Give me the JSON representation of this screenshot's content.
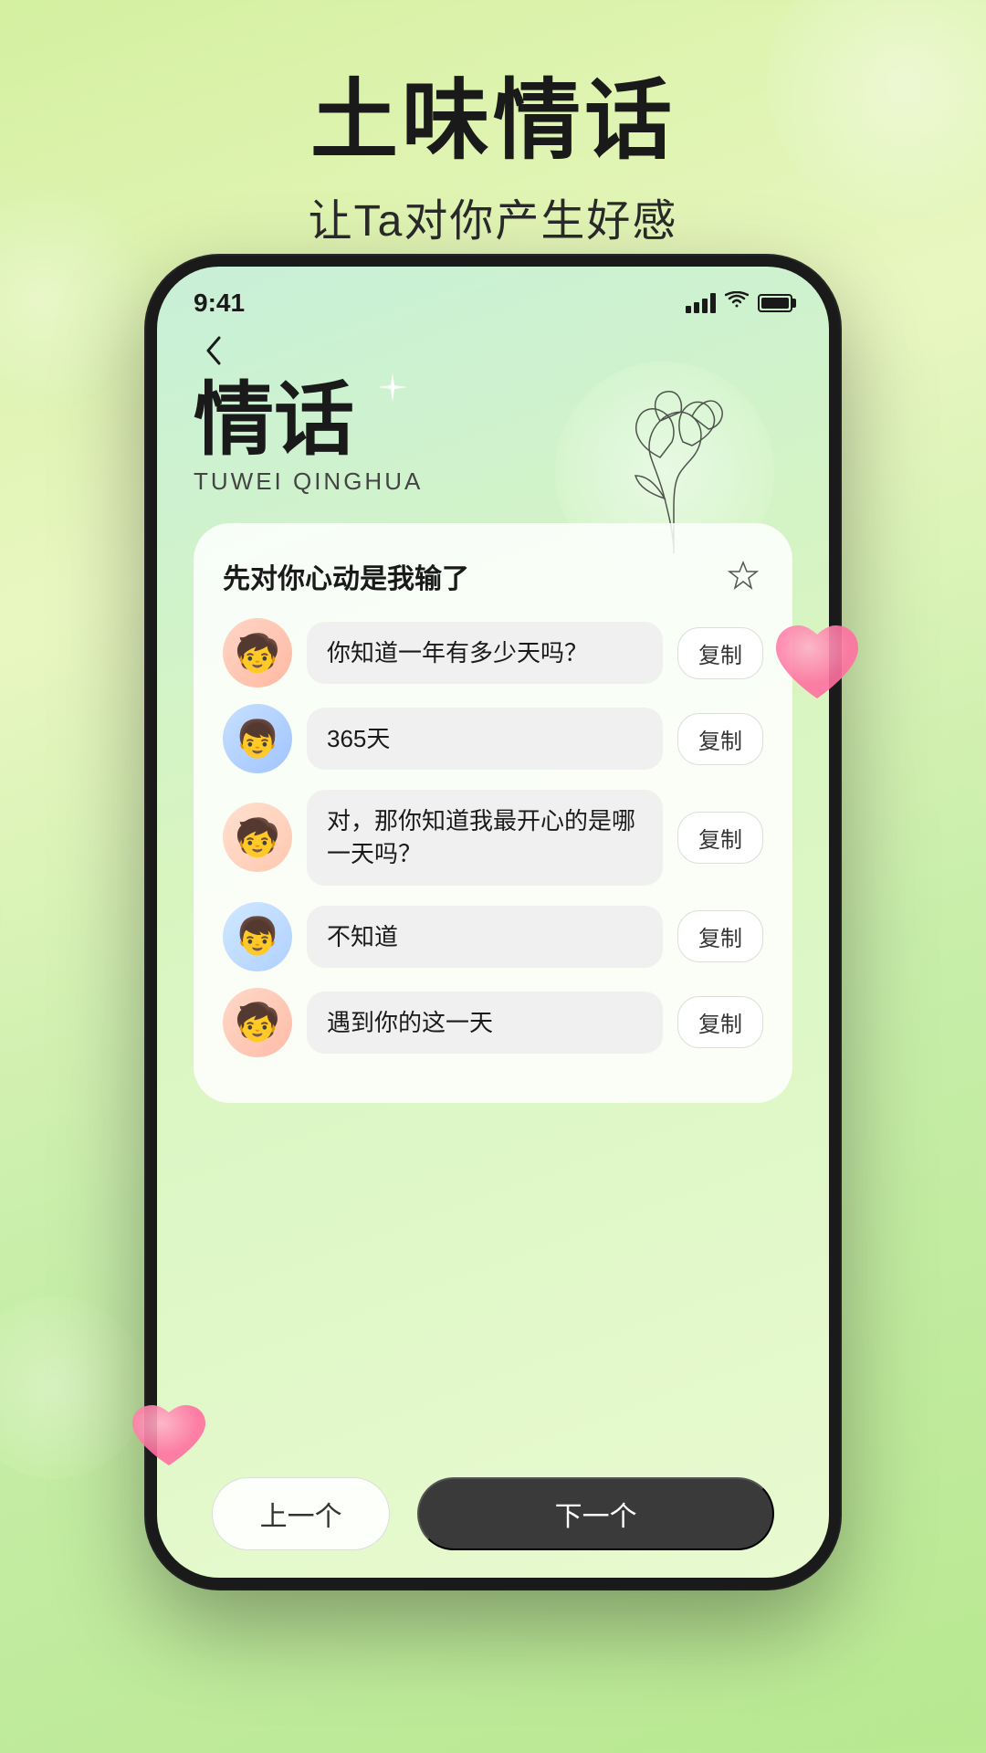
{
  "page": {
    "title_main": "土味情话",
    "subtitle": "让Ta对你产生好感",
    "background_colors": {
      "top": "#d4f0a0",
      "bottom": "#b8e890"
    }
  },
  "status_bar": {
    "time": "9:41",
    "signal_alt": "signal bars",
    "wifi_alt": "wifi",
    "battery_alt": "battery"
  },
  "app": {
    "back_label": "‹",
    "title_cn": "情话",
    "title_en": "TUWEI QINGHUA",
    "card_title": "先对你心动是我输了",
    "star_label": "☆",
    "chat_rows": [
      {
        "id": 1,
        "avatar_type": "girl",
        "text": "你知道一年有多少天吗？",
        "copy_label": "复制"
      },
      {
        "id": 2,
        "avatar_type": "boy",
        "text": "365天",
        "copy_label": "复制"
      },
      {
        "id": 3,
        "avatar_type": "girl",
        "text": "对，那你知道我最开心的是哪一天吗？",
        "copy_label": "复制"
      },
      {
        "id": 4,
        "avatar_type": "boy",
        "text": "不知道",
        "copy_label": "复制"
      },
      {
        "id": 5,
        "avatar_type": "girl",
        "text": "遇到你的这一天",
        "copy_label": "复制"
      }
    ],
    "nav": {
      "prev_label": "上一个",
      "next_label": "下一个"
    }
  }
}
